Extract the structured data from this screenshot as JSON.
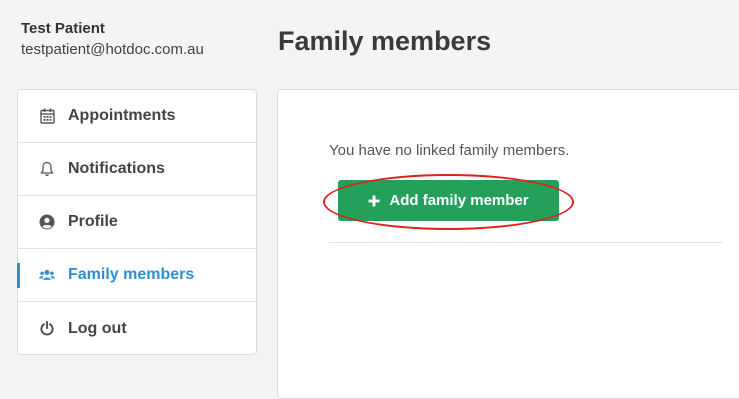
{
  "user": {
    "name": "Test Patient",
    "email": "testpatient@hotdoc.com.au"
  },
  "page": {
    "title": "Family members"
  },
  "sidebar": {
    "items": [
      {
        "label": "Appointments",
        "icon": "calendar-icon",
        "active": false
      },
      {
        "label": "Notifications",
        "icon": "bell-icon",
        "active": false
      },
      {
        "label": "Profile",
        "icon": "user-circle-icon",
        "active": false
      },
      {
        "label": "Family members",
        "icon": "users-icon",
        "active": true
      },
      {
        "label": "Log out",
        "icon": "power-icon",
        "active": false
      }
    ]
  },
  "main": {
    "empty_message": "You have no linked family members.",
    "add_button_label": "Add family member",
    "add_button_icon": "plus-icon"
  },
  "colors": {
    "accent": "#2f8fd0",
    "button_green": "#24a05a",
    "annotation_red": "#e0201a"
  }
}
